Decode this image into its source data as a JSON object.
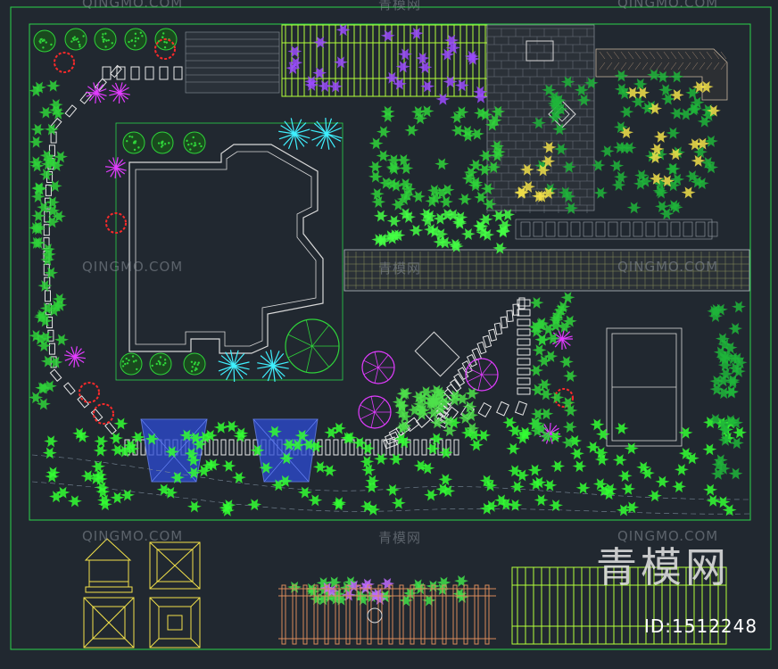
{
  "watermarks": {
    "latin": "QINGMO.COM",
    "cn": "青模网",
    "big": "青模网",
    "id_text": "ID:1512248"
  },
  "colors": {
    "background": "#212830",
    "frame": "#2bd44a",
    "building": "#d8d8d8",
    "paving": "#b5bcc4",
    "pergola": "#b3ff3a",
    "cyan_tree": "#3ff0ff",
    "magenta_tree": "#e23cff",
    "red_shrub": "#ff2a2a",
    "green_shrub": "#2fd33a",
    "yellow_detail": "#f2e14a",
    "path_stones": "#e8e8e8",
    "shade_sail": "#2c4bd6"
  },
  "legend_icons": [
    "pavilion-elevation-icon",
    "pavilion-roof-plan-icon",
    "pavilion-base-plan-icon",
    "pavilion-ceiling-plan-icon",
    "pergola-elevation-icon",
    "pergola-plan-icon"
  ]
}
